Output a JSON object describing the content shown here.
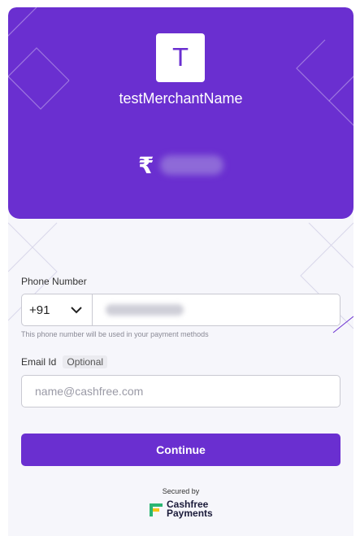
{
  "merchant": {
    "logo_letter": "T",
    "name": "testMerchantName",
    "currency_symbol": "₹"
  },
  "form": {
    "phone_label": "Phone Number",
    "country_code": "+91",
    "phone_hint": "This phone number will be used in your payment methods",
    "email_label": "Email Id",
    "email_optional": "Optional",
    "email_placeholder": "name@cashfree.com",
    "continue_label": "Continue"
  },
  "footer": {
    "secured_by": "Secured by",
    "brand_line1": "Cashfree",
    "brand_line2": "Payments"
  },
  "colors": {
    "brand_purple": "#6a2fd0",
    "page_bg": "#f6f6fb",
    "logo_green": "#2bb673",
    "logo_yellow": "#f5c518"
  }
}
